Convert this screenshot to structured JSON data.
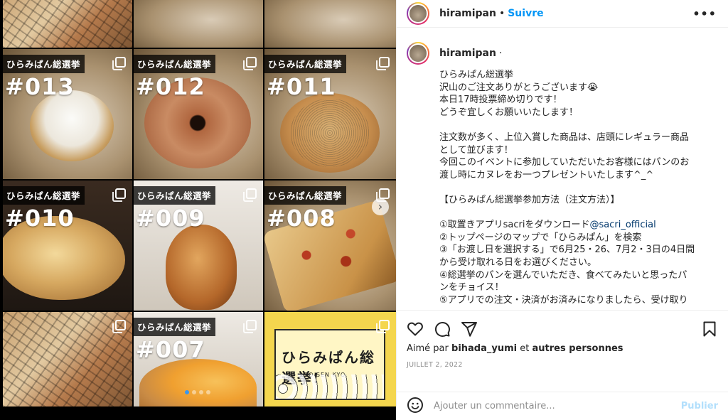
{
  "post": {
    "username": "hiramipan",
    "follow_label": "Suivre",
    "separator": "•",
    "more_label": "•••",
    "caption_separator": "·",
    "caption_lines": [
      "ひらみぱん総選挙",
      "沢山のご注文ありがとうございます😭",
      "本日17時投票締め切りです！",
      "どうぞ宜しくお願いいたします！",
      "",
      "注文数が多く、上位入賞した商品は、店頭にレギュラー商品",
      "として並びます！",
      "今回このイベントに参加していただいたお客様にはパンのお",
      "渡し時にカヌレをお一つプレゼントいたします^_^",
      "",
      "【ひらみぱん総選挙参加方法（注文方法）】",
      "",
      "①取置きアプリsacriをダウンロード",
      "②トップページのマップで「ひらみぱん」を検索",
      "③「お渡し日を選択する」で6月25・26、7月2・3日の4日間",
      "から受け取れる日をお選びください。",
      "④総選挙のパンを選んでいただき、食べてみたいと思ったパ",
      "ンをチョイス！",
      "⑤アプリでの注文・決済がお済みになりましたら、受け取り"
    ],
    "mention": "@sacri_official",
    "likes_prefix": "Aimé par",
    "likes_user": "bihada_yumi",
    "likes_middle": "et",
    "likes_suffix": "autres personnes",
    "date": "JUILLET 2, 2022",
    "comment_placeholder": "Ajouter un commentaire...",
    "publish_label": "Publier"
  },
  "media": {
    "tag_label": "ひらみぱん総選挙",
    "numbers": [
      "#013",
      "#012",
      "#011",
      "#010",
      "#009",
      "#008",
      "#007"
    ],
    "poster_title": "ひらみぱん総選挙!",
    "poster_sub": "SO SEN KYO",
    "next_arrow": "›"
  },
  "icons": [
    "heart-icon",
    "comment-icon",
    "share-icon",
    "bookmark-icon",
    "emoji-icon",
    "more-icon"
  ],
  "colors": {
    "accent": "#0095f6",
    "publish": "#b2dffc",
    "link": "#00376b"
  }
}
